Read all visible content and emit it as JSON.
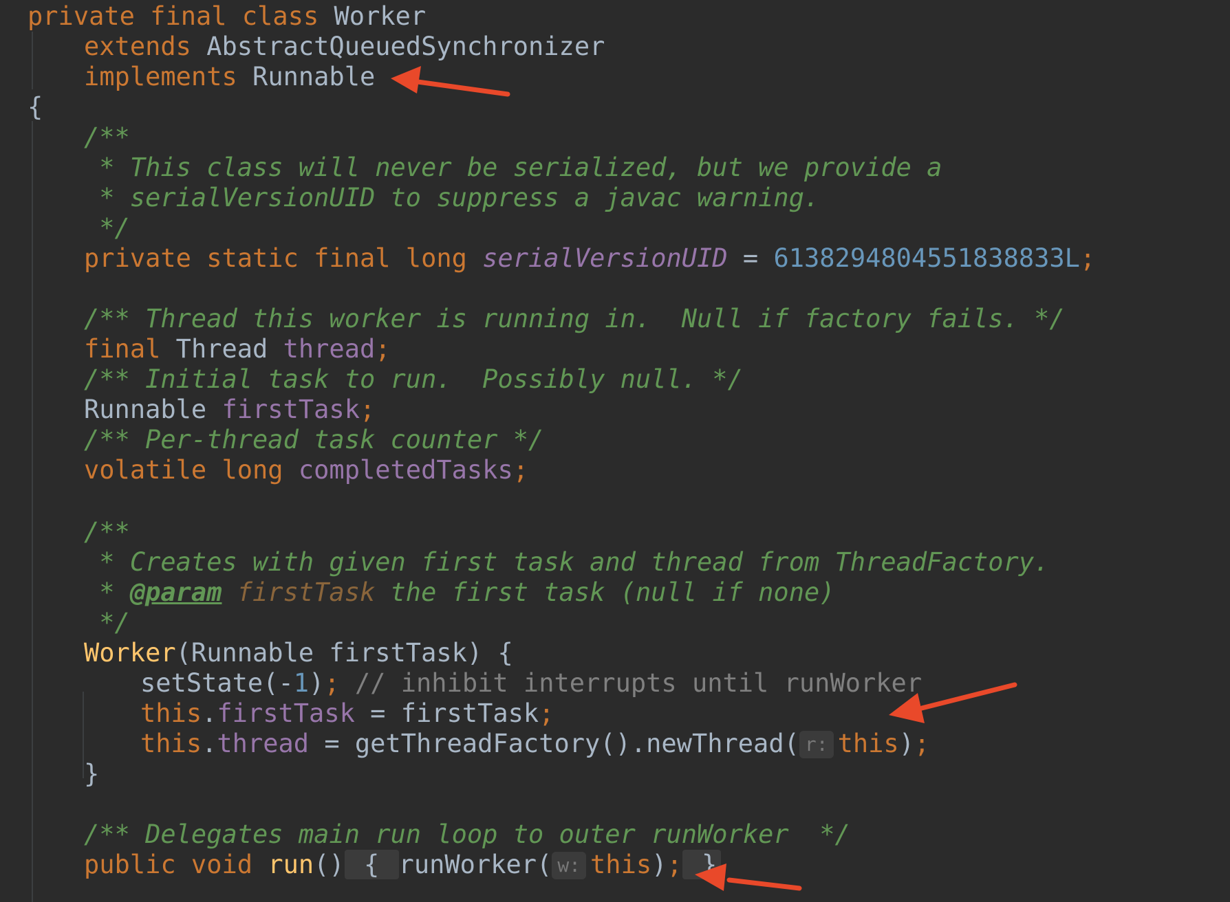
{
  "editor": {
    "lines": {
      "l1": {
        "a": "private final class",
        "b": " Worker"
      },
      "l2": {
        "a": "extends",
        "b": " AbstractQueuedSynchronizer"
      },
      "l3": {
        "a": "implements",
        "b": " Runnable"
      },
      "l4": {
        "a": "{"
      },
      "l5": {
        "a": "/**"
      },
      "l6": {
        "a": " * This class will never be serialized, but we provide a"
      },
      "l7": {
        "a": " * serialVersionUID to suppress a javac warning."
      },
      "l8": {
        "a": " */"
      },
      "l9": {
        "a": "private static final long",
        "b": "serialVersionUID",
        "c": " = ",
        "d": "6138294804551838833L",
        "e": ";"
      },
      "l10": {
        "a": "/** Thread this worker is running in.  Null if factory fails. */"
      },
      "l11": {
        "a": "final",
        "b": " Thread ",
        "c": "thread",
        "d": ";"
      },
      "l12": {
        "a": "/** Initial task to run.  Possibly null. */"
      },
      "l13": {
        "a": "Runnable ",
        "b": "firstTask",
        "c": ";"
      },
      "l14": {
        "a": "/** Per-thread task counter */"
      },
      "l15": {
        "a": "volatile long",
        "b": " completedTasks",
        "c": ";"
      },
      "l16": {
        "a": "/**"
      },
      "l17": {
        "a": " * Creates with given first task and thread from ThreadFactory."
      },
      "l18": {
        "a": " * ",
        "b": "@param",
        "c": " firstTask",
        "d": " the first task (null if none)"
      },
      "l19": {
        "a": " */"
      },
      "l20": {
        "a": "Worker",
        "b": "(Runnable firstTask) {"
      },
      "l21": {
        "a": "setState(-",
        "b": "1",
        "c": ")",
        "d": ";",
        "e": " // inhibit interrupts until runWorker"
      },
      "l22": {
        "a": "this",
        "b": ".",
        "c": "firstTask",
        "d": " = firstTask",
        "e": ";"
      },
      "l23": {
        "a": "this",
        "b": ".",
        "c": "thread",
        "d": " = getThreadFactory().newThread(",
        "hint": "r:",
        "e": "this",
        "f": ")",
        "g": ";"
      },
      "l24": {
        "a": "}"
      },
      "l25": {
        "a": "/** Delegates main run loop to outer runWorker  */"
      },
      "l26": {
        "a": "public void",
        "b": "run",
        "c": "()",
        "d": " { ",
        "e": "runWorker(",
        "hint": "w:",
        "f": "this",
        "g": ")",
        "h": ";",
        "i": " }"
      }
    }
  },
  "colors": {
    "background": "#2b2b2b",
    "keyword": "#cc7832",
    "doc_comment": "#629755",
    "field": "#9876aa",
    "number": "#6897bb",
    "line_comment": "#808080",
    "method_decl": "#ffc66d",
    "arrow": "#e9492a"
  }
}
